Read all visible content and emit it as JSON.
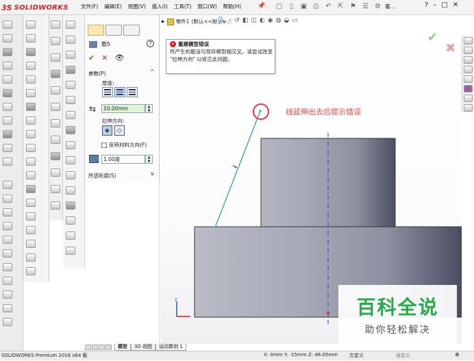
{
  "app": {
    "logo_ds": "3S",
    "logo_name": "SOLIDWORKS"
  },
  "menu": [
    "文件(F)",
    "编辑(E)",
    "视图(V)",
    "插入(I)",
    "工具(T)",
    "窗口(W)",
    "帮助(H)"
  ],
  "quick_access": {
    "search_label": "著..."
  },
  "window_controls": {
    "help": "?",
    "minimize": "–",
    "restore": "□",
    "close": "✕"
  },
  "property_manager": {
    "feature_name": "筋5",
    "help": "?",
    "parameters_section": "参数(P)",
    "thickness_label": "厚度:",
    "depth_value": "10.00mm",
    "extrusion_direction_label": "拉伸方向:",
    "flip_material_side": "反转材料方向(F)",
    "draft_value": "1.00度",
    "selected_contours_section": "所选轮廓(S)"
  },
  "feature_tree": {
    "part_name": "零件1",
    "config": "(默认<<默认>..."
  },
  "error_popup": {
    "title": "重建模型错误",
    "body": "所产生的筋没与现存模型相交叉。请尝试改变 \"拉伸方向\" 以修正此问题。"
  },
  "annotation": {
    "text": "线延伸出去后提示错误",
    "color": "#ee4444"
  },
  "bottom_tabs": [
    "模型",
    "3D 视图",
    "运动算例 1"
  ],
  "status": {
    "product": "SOLIDWORKS Premium 2016 x64 板",
    "coords": "X: 0mm Y: -15mm Z: 46.05mm",
    "definition": "欠定义",
    "custom": "自定义"
  },
  "watermark": {
    "line1": "百科全说",
    "line2": "助你轻松解决"
  },
  "colors": {
    "accent_red": "#d2232a",
    "ok_green": "#2a9a2a",
    "model_face": "#8a8d9c"
  }
}
